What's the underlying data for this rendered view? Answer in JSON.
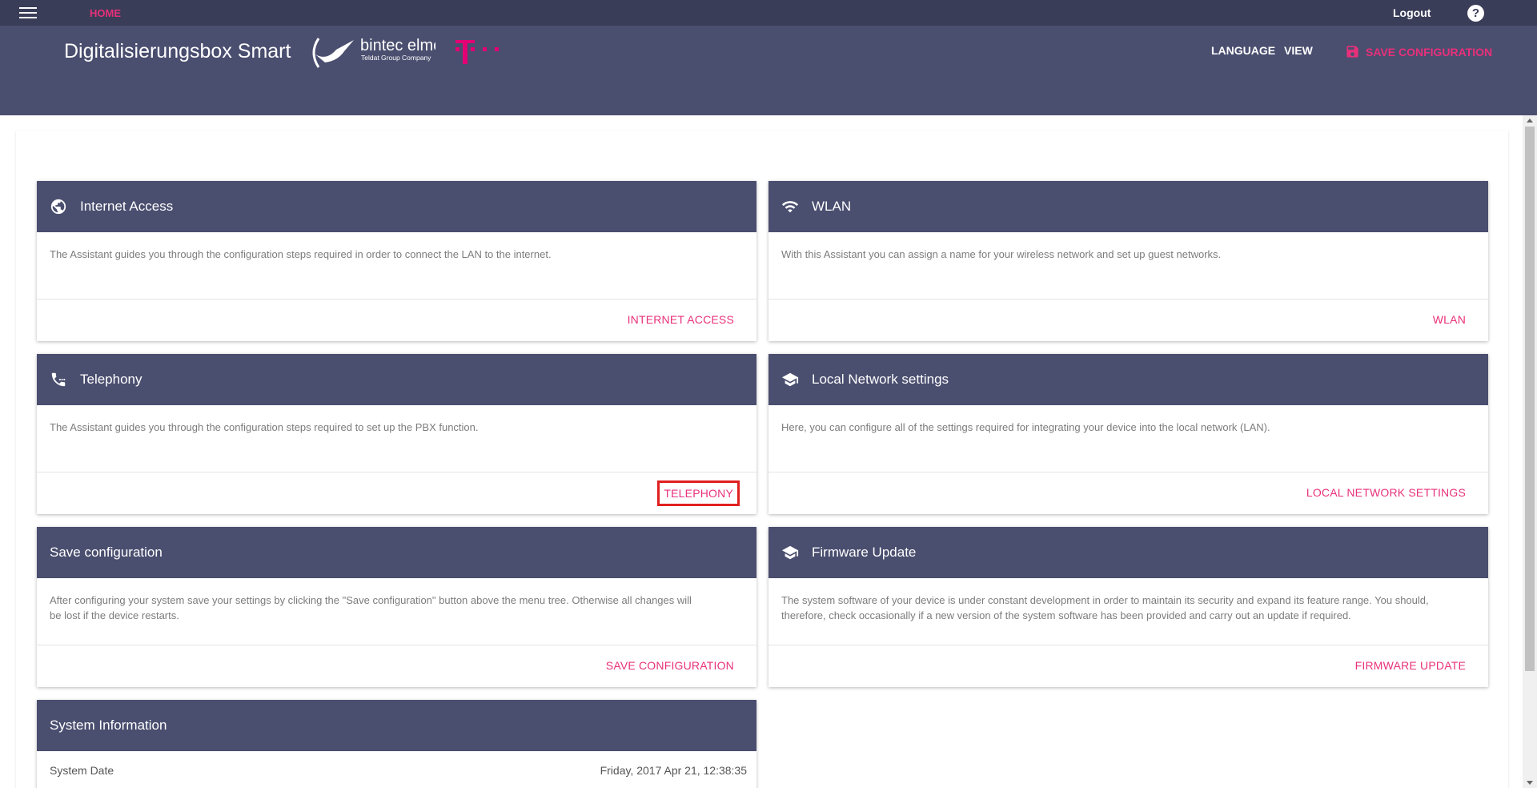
{
  "topbar": {
    "home": "HOME",
    "logout": "Logout",
    "help": "?"
  },
  "header": {
    "title": "Digitalisierungsbox Smart",
    "brand_name": "bintec elmeg",
    "brand_sub": "Teldat Group Company",
    "language": "LANGUAGE",
    "view": "VIEW",
    "save": "SAVE CONFIGURATION"
  },
  "cards": [
    {
      "title": "Internet Access",
      "icon": "globe-icon",
      "body": "The Assistant guides you through the configuration steps required in order to connect the LAN to the internet.",
      "action": "INTERNET ACCESS"
    },
    {
      "title": "WLAN",
      "icon": "wifi-icon",
      "body": "With this Assistant you can assign a name for your wireless network and set up guest networks.",
      "action": "WLAN"
    },
    {
      "title": "Telephony",
      "icon": "phone-icon",
      "body": "The Assistant guides you through the configuration steps required to set up the PBX function.",
      "action": "TELEPHONY"
    },
    {
      "title": "Local Network settings",
      "icon": "school-icon",
      "body": "Here, you can configure all of the settings required for integrating your device into the local network (LAN).",
      "action": "LOCAL NETWORK SETTINGS"
    },
    {
      "title": "Save configuration",
      "body": "After configuring your system save your settings by clicking the \"Save configuration\" button above the menu tree. Otherwise all changes will be lost if the device restarts.",
      "action": "SAVE CONFIGURATION"
    },
    {
      "title": "Firmware Update",
      "icon": "school-icon",
      "body": "The system software of your device is under constant development in order to maintain its security and expand its feature range. You should, therefore, check occasionally if a new version of the system software has been provided and carry out an update if required.",
      "action": "FIRMWARE UPDATE"
    }
  ],
  "system_info": {
    "title": "System Information",
    "date_label": "System Date",
    "date_value": "Friday, 2017 Apr 21, 12:38:35"
  },
  "colors": {
    "accent": "#e8307a",
    "header": "#4a4e6f",
    "topbar": "#3a3d58",
    "highlight": "#e02020"
  }
}
